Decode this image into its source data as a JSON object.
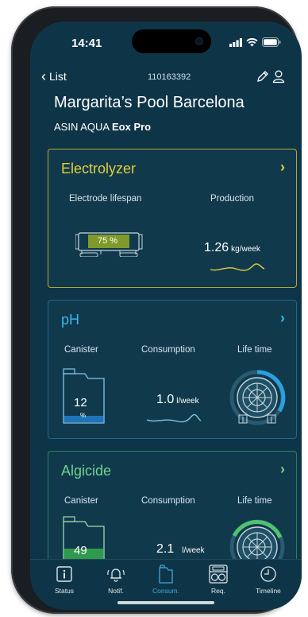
{
  "status_bar": {
    "time": "14:41",
    "icons": [
      "signal-icon",
      "wifi-icon",
      "battery-icon"
    ]
  },
  "nav": {
    "back_label": "List",
    "serial": "110163392",
    "icons": [
      "edit-icon",
      "user-icon"
    ]
  },
  "header": {
    "title": "Margarita’s Pool Barcelona",
    "brand": "ASIN AQUA",
    "model": "Eox Pro"
  },
  "colors": {
    "background": "#0e3547",
    "electrolyzer": "#e3cf3a",
    "ph": "#3fb3f0",
    "algicide": "#6fd38d",
    "active_tab": "#3fa7df"
  },
  "cards": {
    "electrolyzer": {
      "title": "Electrolyzer",
      "lifespan_label": "Electrode lifespan",
      "lifespan_value": "75 %",
      "lifespan_fraction": 0.75,
      "production_label": "Production",
      "production_value": "1.26",
      "production_unit": "kg/week"
    },
    "ph": {
      "title": "pH",
      "canister_label": "Canister",
      "canister_value": "12",
      "canister_unit": "%",
      "canister_fraction": 0.12,
      "consumption_label": "Consumption",
      "consumption_value": "1.0",
      "consumption_unit": "l/week",
      "lifetime_label": "Life time"
    },
    "algicide": {
      "title": "Algicide",
      "canister_label": "Canister",
      "canister_value": "49",
      "canister_fraction": 0.49,
      "consumption_label": "Consumption",
      "consumption_value": "2.1",
      "consumption_unit": "l/week",
      "lifetime_label": "Life time"
    }
  },
  "tabs": [
    {
      "label": "Status",
      "icon": "info-icon"
    },
    {
      "label": "Notif.",
      "icon": "bell-icon"
    },
    {
      "label": "Consum.",
      "icon": "canister-icon",
      "active": true
    },
    {
      "label": "Req.",
      "icon": "device-icon"
    },
    {
      "label": "Timeline",
      "icon": "clock-icon"
    }
  ]
}
